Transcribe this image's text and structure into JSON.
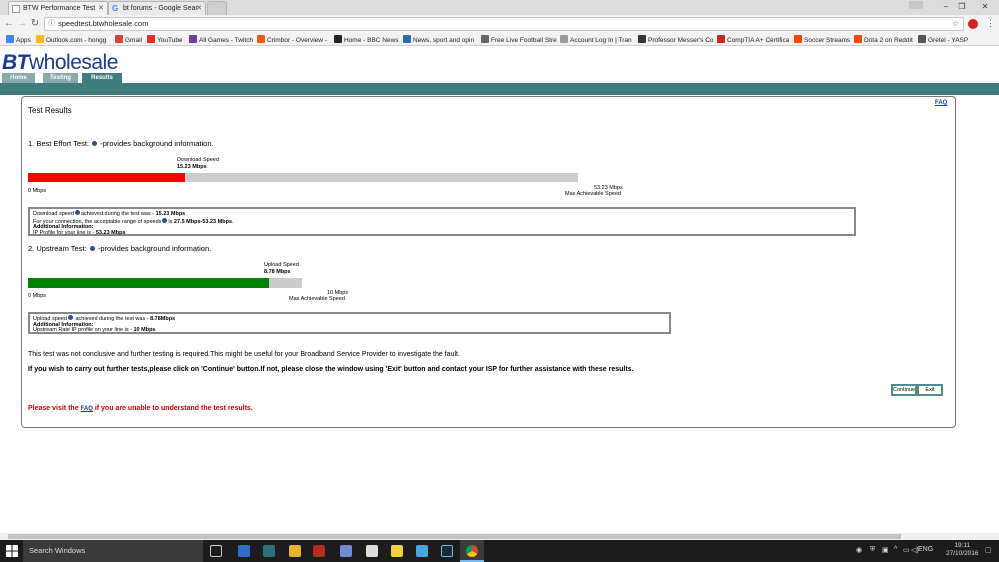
{
  "browser": {
    "tabs": [
      {
        "title": "BTW Performance Test",
        "active": true
      },
      {
        "title": "bt forums - Google Sear",
        "active": false
      }
    ],
    "url": "speedtest.btwholesale.com",
    "bookmarks": [
      "Apps",
      "Outlook.com - hongg",
      "Gmail",
      "YouTube",
      "All Games - Twitch",
      "Crimbor - Overview -",
      "Home - BBC News",
      "News, sport and opin",
      "Free Live Football Stre",
      "Account Log In | Tran",
      "Professor Messer's Co",
      "CompTIA A+ Certifica",
      "Soccer Streams",
      "Dota 2 on Reddit",
      "Gretel - YASP"
    ]
  },
  "header": {
    "logo_bt": "BT",
    "logo_rest": "wholesale",
    "nav_tabs": [
      "Home",
      "Testing",
      "Results"
    ]
  },
  "results": {
    "section_title": "Test Results",
    "faq_link": "FAQ",
    "best_effort": {
      "heading_prefix": "1. Best Effort Test:",
      "heading_suffix": "-provides background information.",
      "speed_label": "Download Speed",
      "speed_value": "15.23 Mbps",
      "min_label": "0 Mbps",
      "max_value": "53.23 Mbps",
      "max_label": "Max Achievable Speed",
      "measured": 15.23,
      "max": 53.23,
      "bar_color": "#ff0000",
      "box_line1_pre": "Download speed",
      "box_line1_mid": "achieved during the test was - ",
      "box_line1_val": "15.23 Mbps",
      "box_line2_pre": "For your connection, the acceptable range of speeds",
      "box_line2_mid": "is ",
      "box_line2_val": "27.5 Mbps-53.23 Mbps",
      "box_line2_end": ".",
      "box_line3": "Additional Information:",
      "box_line4_pre": "IP Profile for your line is - ",
      "box_line4_val": "53.23 Mbps"
    },
    "upstream": {
      "heading_prefix": "2. Upstream Test:",
      "heading_suffix": "-provides background information.",
      "speed_label": "Upload Speed",
      "speed_value": "8.78 Mbps",
      "min_label": "0 Mbps",
      "max_value": "10 Mbps",
      "max_label": "Max Achievable Speed",
      "measured": 8.78,
      "max": 10,
      "bar_color": "#008000",
      "box_line1_pre": "Upload speed",
      "box_line1_mid": " achieved during the test was - ",
      "box_line1_val": "8.78Mbps",
      "box_line2": "Additional Information:",
      "box_line3_pre": "Upstream Rate IP profile on your line is - ",
      "box_line3_val": "10 Mbps"
    },
    "inconclusive_msg": "This test was not conclusive and further testing is required.This might be useful for your Broadband Service Provider to investigate the fault.",
    "continue_msg": "If you wish to carry out further tests,please click on 'Continue' button.If not, please close the window using 'Exit' button and contact your ISP for further assistance with these results.",
    "continue_button": "Continue",
    "exit_button": "Exit",
    "faq_msg_pre": "Please visit the ",
    "faq_msg_link": "FAQ",
    "faq_msg_post": " if you are unable to understand the test results."
  },
  "taskbar": {
    "search_placeholder": "Search Windows",
    "language": "ENG",
    "time": "19:11",
    "date": "27/10/2016"
  }
}
